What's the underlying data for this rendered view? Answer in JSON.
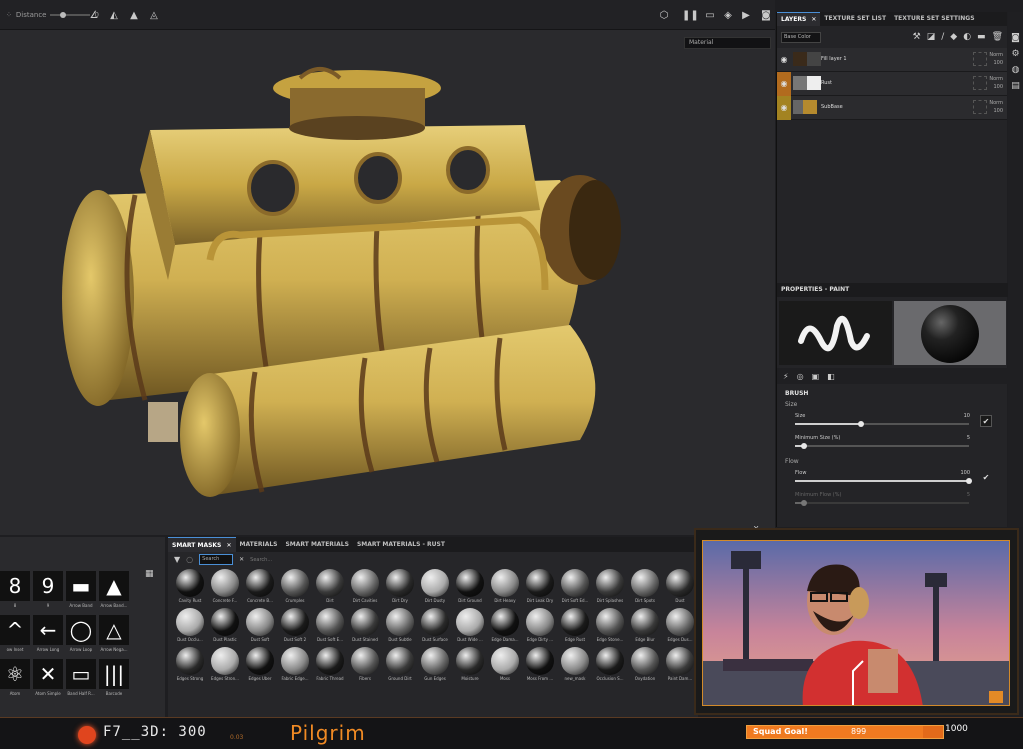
{
  "toolbar": {
    "distance_label": "Distance",
    "distance_value": "0"
  },
  "viewport": {
    "display_mode": "Material",
    "axes_label_y": "Y",
    "axes_label_x": "X",
    "axes_label_z": "Z"
  },
  "layers_panel": {
    "tabs": [
      {
        "label": "LAYERS",
        "active": true
      },
      {
        "label": "TEXTURE SET LIST",
        "active": false
      },
      {
        "label": "TEXTURE SET SETTINGS",
        "active": false
      }
    ],
    "channel": "Base Color",
    "layers": [
      {
        "name": "Fill layer 1",
        "blend": "Norm",
        "opacity": "100"
      },
      {
        "name": "Rust",
        "blend": "Norm",
        "opacity": "100"
      },
      {
        "name": "SubBase",
        "blend": "Norm",
        "opacity": "100"
      }
    ]
  },
  "properties": {
    "title": "PROPERTIES - PAINT",
    "section": "BRUSH",
    "size_group": "Size",
    "size_label": "Size",
    "size_value": "10",
    "size_fraction": 0.38,
    "min_size_label": "Minimum Size (%)",
    "min_size_value": "5",
    "min_size_fraction": 0.05,
    "flow_group": "Flow",
    "flow_label": "Flow",
    "flow_value": "100",
    "flow_fraction": 1.0,
    "min_flow_label": "Minimum Flow (%)",
    "min_flow_value": "5",
    "min_flow_fraction": 0.05
  },
  "alphas": [
    {
      "glyph": "8",
      "label": "8"
    },
    {
      "glyph": "9",
      "label": "9"
    },
    {
      "glyph": "▬",
      "label": "Arrow Band"
    },
    {
      "glyph": "▲",
      "label": "Arrow Band..."
    },
    {
      "glyph": "^",
      "label": "ow Inset"
    },
    {
      "glyph": "←",
      "label": "Arrow Long"
    },
    {
      "glyph": "◯",
      "label": "Arrow Loop"
    },
    {
      "glyph": "△",
      "label": "Arrow Nega..."
    },
    {
      "glyph": "⚛",
      "label": "Atom"
    },
    {
      "glyph": "✕",
      "label": "Atom Simple"
    },
    {
      "glyph": "▭",
      "label": "Band Half R..."
    },
    {
      "glyph": "|||",
      "label": "Barcode"
    }
  ],
  "shelf": {
    "tabs": [
      {
        "label": "SMART MASKS",
        "active": true
      },
      {
        "label": "MATERIALS",
        "active": false
      },
      {
        "label": "SMART MATERIALS",
        "active": false
      },
      {
        "label": "SMART MATERIALS - RUST",
        "active": false
      }
    ],
    "search_placeholder": "Search",
    "search2_placeholder": "Search...",
    "items": [
      "Cavity Rust",
      "Concrete F...",
      "Concrete B...",
      "Crumples",
      "Dirt",
      "Dirt Cavities",
      "Dirt Dry",
      "Dirt Dusty",
      "Dirt Ground",
      "Dirt Heavy",
      "Dirt Leak Dry",
      "Dirt Soft Ed...",
      "Dirt Splashes",
      "Dirt Spots",
      "Dust",
      "Dust Occlu...",
      "Dust Plastic",
      "Dust Soft",
      "Dust Soft 2",
      "Dust Soft E...",
      "Dust Stained",
      "Dust Subtle",
      "Dust Surface",
      "Dust Wide ...",
      "Edge Dama...",
      "Edge Dirty ...",
      "Edge Rust",
      "Edge Stone...",
      "Edge Blur",
      "Edges Dus...",
      "Edges Strong",
      "Edges Stron...",
      "Edges Uber",
      "Fabric Edge...",
      "Fabric Thread",
      "Fibers",
      "Ground Dirt",
      "Gun Edges",
      "Moisture",
      "Moss",
      "Moss From ...",
      "new_mask",
      "Occlusion S...",
      "Oxydation",
      "Paint Dam..."
    ]
  },
  "stream": {
    "code": "F7__3D: 300",
    "small_label": "0.03",
    "name": "Pilgrim",
    "goal_label": "Squad Goal!",
    "goal_value": "899",
    "goal_max": "1000",
    "goal_fraction": 0.899
  },
  "colors": {
    "accent_blue": "#4a8fd6",
    "rust_orange": "#b26b1e",
    "stream_orange": "#f08a24"
  }
}
